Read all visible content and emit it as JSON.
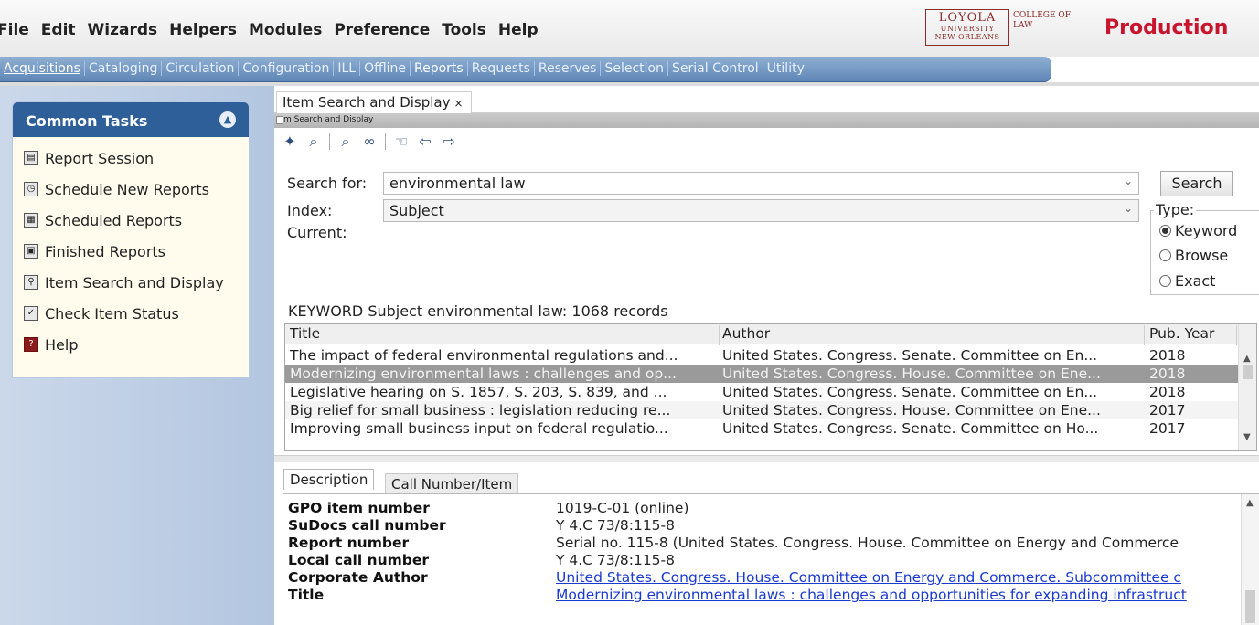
{
  "menubar": {
    "items": [
      "File",
      "Edit",
      "Wizards",
      "Helpers",
      "Modules",
      "Preference",
      "Tools",
      "Help"
    ],
    "logo": {
      "line1": "LOYOLA",
      "line2": "UNIVERSITY",
      "line3": "NEW ORLEANS",
      "college": "COLLEGE OF",
      "law": "LAW"
    },
    "environment": "Production"
  },
  "modules": {
    "items": [
      "Acquisitions",
      "Cataloging",
      "Circulation",
      "Configuration",
      "ILL",
      "Offline",
      "Reports",
      "Requests",
      "Reserves",
      "Selection",
      "Serial Control",
      "Utility"
    ],
    "active": "Acquisitions"
  },
  "tasks": {
    "title": "Common Tasks",
    "items": [
      {
        "label": "Report Session",
        "icon": "report-session-icon"
      },
      {
        "label": "Schedule New Reports",
        "icon": "schedule-icon"
      },
      {
        "label": "Scheduled Reports",
        "icon": "scheduled-reports-icon"
      },
      {
        "label": "Finished Reports",
        "icon": "finished-reports-icon"
      },
      {
        "label": "Item Search and Display",
        "icon": "item-search-icon"
      },
      {
        "label": "Check Item Status",
        "icon": "check-status-icon"
      },
      {
        "label": "Help",
        "icon": "help-icon"
      }
    ]
  },
  "main": {
    "tab_label": "Item Search and Display",
    "tab_close": "×",
    "subtitle": "m Search and Display",
    "search": {
      "search_for_label": "Search for:",
      "search_for_value": "environmental law",
      "index_label": "Index:",
      "index_value": "Subject",
      "current_label": "Current:",
      "search_button": "Search",
      "type_label": "Type:",
      "types": [
        "Keyword",
        "Browse",
        "Exact"
      ],
      "selected_type": "Keyword"
    },
    "results": {
      "summary": "KEYWORD Subject environmental law: 1068 records",
      "columns": [
        "Title",
        "Author",
        "Pub. Year"
      ],
      "rows": [
        [
          "The impact of federal environmental regulations and...",
          "United States. Congress. Senate. Committee on En...",
          "2018"
        ],
        [
          "Modernizing environmental laws : challenges and op...",
          "United States. Congress. House. Committee on Ene...",
          "2018"
        ],
        [
          "Legislative hearing on S. 1857, S. 203, S. 839, and ...",
          "United States. Congress. Senate. Committee on En...",
          "2018"
        ],
        [
          "Big relief for small business : legislation reducing re...",
          "United States. Congress. House. Committee on Ene...",
          "2017"
        ],
        [
          "Improving small business input on federal regulatio...",
          "United States. Congress. Senate. Committee on Ho...",
          "2017"
        ]
      ],
      "selected_row": 1
    },
    "detail": {
      "tabs": [
        "Description",
        "Call Number/Item"
      ],
      "rows": [
        {
          "key": "GPO item number",
          "value": "1019-C-01 (online)"
        },
        {
          "key": "SuDocs call number",
          "value": "Y 4.C 73/8:115-8"
        },
        {
          "key": "Report number",
          "value": "Serial no. 115-8 (United States. Congress. House. Committee on Energy and Commerce"
        },
        {
          "key": "Local call number",
          "value": "Y 4.C 73/8:115-8"
        },
        {
          "key": "Corporate Author",
          "value": "United States. Congress. House. Committee on Energy and Commerce. Subcommittee c",
          "link": true
        },
        {
          "key": "Title",
          "value": "Modernizing environmental laws : challenges and opportunities for expanding infrastruct",
          "link": true
        }
      ]
    }
  }
}
